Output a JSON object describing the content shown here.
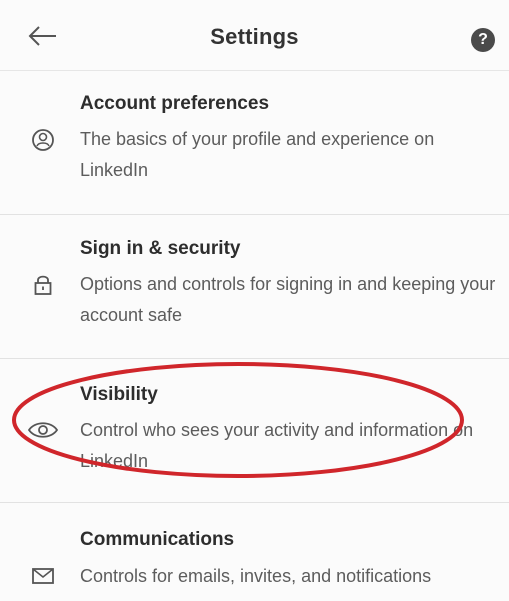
{
  "header": {
    "back_icon": "arrow-left-icon",
    "title": "Settings",
    "help_icon": "question-circle-icon",
    "help_glyph": "?"
  },
  "items": [
    {
      "icon": "user-circle-icon",
      "title": "Account preferences",
      "description": "The basics of your profile and experience on LinkedIn"
    },
    {
      "icon": "lock-icon",
      "title": "Sign in & security",
      "description": "Options and controls for signing in and keeping your account safe"
    },
    {
      "icon": "eye-icon",
      "title": "Visibility",
      "description": "Control who sees your activity and information on LinkedIn"
    },
    {
      "icon": "envelope-icon",
      "title": "Communications",
      "description": "Controls for emails, invites, and notifications"
    }
  ],
  "annotation": {
    "type": "red-ellipse-highlight",
    "target": "Visibility",
    "color": "#d0262b"
  }
}
